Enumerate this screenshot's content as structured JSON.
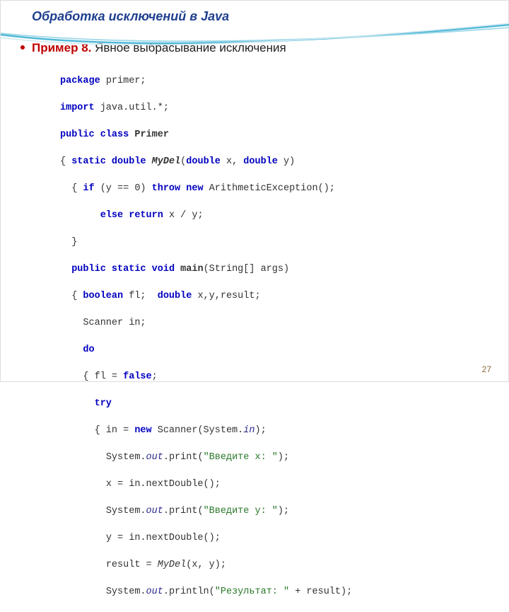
{
  "title": "Обработка исключений в Java",
  "example_label": "Пример 8.",
  "example_text": " Явное выбрасывание исключения",
  "page_number": "27",
  "code": {
    "l1_kw": "package",
    "l1_r": " primer;",
    "l2_kw": "import",
    "l2_r": " java.util.*;",
    "l3_kw1": "public",
    "l3_kw2": "class",
    "l3_name": "Primer",
    "l4_a": "{ ",
    "l4_kw1": "static",
    "l4_kw2": "double",
    "l4_name": "MyDel",
    "l4_kw3": "double",
    "l4_mid": " x, ",
    "l4_kw4": "double",
    "l4_end": " y)",
    "l5_a": "{ ",
    "l5_kw1": "if",
    "l5_mid": " (y == 0) ",
    "l5_kw2": "throw",
    "l5_kw3": "new",
    "l5_end": " ArithmeticException();",
    "l6_kw1": "else",
    "l6_kw2": "return",
    "l6_end": " x / y;",
    "l7": "}",
    "l8_kw1": "public",
    "l8_kw2": "static",
    "l8_kw3": "void",
    "l8_name": "main",
    "l8_end": "(String[] args)",
    "l9_a": "{ ",
    "l9_kw1": "boolean",
    "l9_mid": " fl;  ",
    "l9_kw2": "double",
    "l9_end": " x,y,result;",
    "l10": "Scanner in;",
    "l11_kw": "do",
    "l12_a": "{ fl = ",
    "l12_kw": "false",
    "l12_end": ";",
    "l13_kw": "try",
    "l14_a": "{ in = ",
    "l14_kw": "new",
    "l14_mid": " Scanner(System.",
    "l14_field": "in",
    "l14_end": ");",
    "l15_a": "System.",
    "l15_field": "out",
    "l15_mid": ".print(",
    "l15_str": "\"Введите x: \"",
    "l15_end": ");",
    "l16": "x = in.nextDouble();",
    "l17_a": "System.",
    "l17_field": "out",
    "l17_mid": ".print(",
    "l17_str": "\"Введите y: \"",
    "l17_end": ");",
    "l18": "y = in.nextDouble();",
    "l19_a": "result = ",
    "l19_call": "MyDel",
    "l19_end": "(x, y);",
    "l20_a": "System.",
    "l20_field": "out",
    "l20_mid": ".println(",
    "l20_str": "\"Результат: \"",
    "l20_end": " + result);"
  }
}
